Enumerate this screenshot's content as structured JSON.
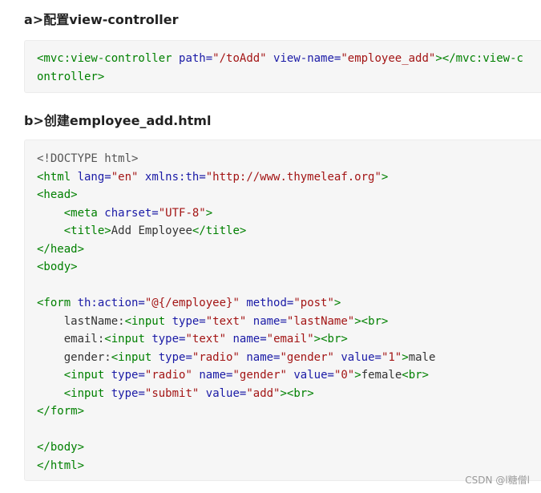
{
  "sections": {
    "a_title": "a>配置view-controller",
    "b_title": "b>创建employee_add.html"
  },
  "code1": {
    "lines": [
      [
        [
          "tag",
          "<mvc:view-controller "
        ],
        [
          "attr",
          "path="
        ],
        [
          "str",
          "\"/toAdd\""
        ],
        [
          "txt",
          " "
        ],
        [
          "attr",
          "view-name="
        ],
        [
          "str",
          "\"employee_add\""
        ],
        [
          "tag",
          "></mvc:view-controller>"
        ]
      ]
    ]
  },
  "code2": {
    "lines": [
      [
        [
          "doctype",
          "<!DOCTYPE html>"
        ]
      ],
      [
        [
          "tag",
          "<html "
        ],
        [
          "attr",
          "lang="
        ],
        [
          "str",
          "\"en\""
        ],
        [
          "txt",
          " "
        ],
        [
          "attr",
          "xmlns:th="
        ],
        [
          "str",
          "\"http://www.thymeleaf.org\""
        ],
        [
          "tag",
          ">"
        ]
      ],
      [
        [
          "tag",
          "<head>"
        ]
      ],
      [
        [
          "txt",
          "    "
        ],
        [
          "tag",
          "<meta "
        ],
        [
          "attr",
          "charset="
        ],
        [
          "str",
          "\"UTF-8\""
        ],
        [
          "tag",
          ">"
        ]
      ],
      [
        [
          "txt",
          "    "
        ],
        [
          "tag",
          "<title>"
        ],
        [
          "txt",
          "Add Employee"
        ],
        [
          "tag",
          "</title>"
        ]
      ],
      [
        [
          "tag",
          "</head>"
        ]
      ],
      [
        [
          "tag",
          "<body>"
        ]
      ],
      [],
      [
        [
          "tag",
          "<form "
        ],
        [
          "attr",
          "th:action="
        ],
        [
          "str",
          "\"@{/employee}\""
        ],
        [
          "txt",
          " "
        ],
        [
          "attr",
          "method="
        ],
        [
          "str",
          "\"post\""
        ],
        [
          "tag",
          ">"
        ]
      ],
      [
        [
          "txt",
          "    lastName:"
        ],
        [
          "tag",
          "<input "
        ],
        [
          "attr",
          "type="
        ],
        [
          "str",
          "\"text\""
        ],
        [
          "txt",
          " "
        ],
        [
          "attr",
          "name="
        ],
        [
          "str",
          "\"lastName\""
        ],
        [
          "tag",
          "><br>"
        ]
      ],
      [
        [
          "txt",
          "    email:"
        ],
        [
          "tag",
          "<input "
        ],
        [
          "attr",
          "type="
        ],
        [
          "str",
          "\"text\""
        ],
        [
          "txt",
          " "
        ],
        [
          "attr",
          "name="
        ],
        [
          "str",
          "\"email\""
        ],
        [
          "tag",
          "><br>"
        ]
      ],
      [
        [
          "txt",
          "    gender:"
        ],
        [
          "tag",
          "<input "
        ],
        [
          "attr",
          "type="
        ],
        [
          "str",
          "\"radio\""
        ],
        [
          "txt",
          " "
        ],
        [
          "attr",
          "name="
        ],
        [
          "str",
          "\"gender\""
        ],
        [
          "txt",
          " "
        ],
        [
          "attr",
          "value="
        ],
        [
          "str",
          "\"1\""
        ],
        [
          "tag",
          ">"
        ],
        [
          "txt",
          "male"
        ]
      ],
      [
        [
          "txt",
          "    "
        ],
        [
          "tag",
          "<input "
        ],
        [
          "attr",
          "type="
        ],
        [
          "str",
          "\"radio\""
        ],
        [
          "txt",
          " "
        ],
        [
          "attr",
          "name="
        ],
        [
          "str",
          "\"gender\""
        ],
        [
          "txt",
          " "
        ],
        [
          "attr",
          "value="
        ],
        [
          "str",
          "\"0\""
        ],
        [
          "tag",
          ">"
        ],
        [
          "txt",
          "female"
        ],
        [
          "tag",
          "<br>"
        ]
      ],
      [
        [
          "txt",
          "    "
        ],
        [
          "tag",
          "<input "
        ],
        [
          "attr",
          "type="
        ],
        [
          "str",
          "\"submit\""
        ],
        [
          "txt",
          " "
        ],
        [
          "attr",
          "value="
        ],
        [
          "str",
          "\"add\""
        ],
        [
          "tag",
          "><br>"
        ]
      ],
      [
        [
          "tag",
          "</form>"
        ]
      ],
      [],
      [
        [
          "tag",
          "</body>"
        ]
      ],
      [
        [
          "tag",
          "</html>"
        ]
      ]
    ]
  },
  "watermark": "CSDN @l糖僧l"
}
